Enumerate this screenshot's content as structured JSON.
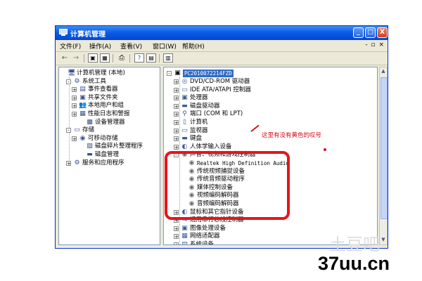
{
  "window": {
    "title": "计算机管理",
    "btn_min": "_",
    "btn_max": "□",
    "btn_close": "X"
  },
  "menubar": {
    "items": [
      "文件(F)",
      "操作(A)",
      "查看(V)",
      "窗口(W)",
      "帮助(H)"
    ],
    "right": "- ▫ ×"
  },
  "toolbar": {
    "buttons": [
      "←",
      "→",
      "▣",
      "▦",
      "⎙",
      "?",
      "▤",
      "▥"
    ]
  },
  "left_tree": {
    "items": [
      {
        "label": "计算机管理 (本地)",
        "icon": "computer-icon",
        "glyph": "🖥",
        "expander": ""
      },
      {
        "label": "系统工具",
        "icon": "tools-icon",
        "glyph": "⚙",
        "expander": "-"
      },
      {
        "label": "事件查看器",
        "icon": "event-viewer-icon",
        "glyph": "▤",
        "expander": "+"
      },
      {
        "label": "共享文件夹",
        "icon": "shared-folder-icon",
        "glyph": "▣",
        "expander": "+"
      },
      {
        "label": "本地用户和组",
        "icon": "users-icon",
        "glyph": "👥",
        "expander": "+"
      },
      {
        "label": "性能日志和警报",
        "icon": "performance-icon",
        "glyph": "▦",
        "expander": "+"
      },
      {
        "label": "设备管理器",
        "icon": "device-manager-icon",
        "glyph": "▩",
        "expander": ""
      },
      {
        "label": "存储",
        "icon": "storage-icon",
        "glyph": "▭",
        "expander": "-"
      },
      {
        "label": "可移动存储",
        "icon": "removable-storage-icon",
        "glyph": "◉",
        "expander": "+"
      },
      {
        "label": "磁盘碎片整理程序",
        "icon": "defrag-icon",
        "glyph": "▨",
        "expander": ""
      },
      {
        "label": "磁盘管理",
        "icon": "disk-management-icon",
        "glyph": "▬",
        "expander": ""
      },
      {
        "label": "服务和应用程序",
        "icon": "services-icon",
        "glyph": "⚙",
        "expander": "+"
      }
    ]
  },
  "right_tree": {
    "root": "PC2010072214FZD",
    "items": [
      {
        "label": "DVD/CD-ROM 驱动器",
        "icon": "cdrom-icon",
        "glyph": "◎",
        "expander": "+"
      },
      {
        "label": "IDE ATA/ATAPI 控制器",
        "icon": "ide-icon",
        "glyph": "▭",
        "expander": "+"
      },
      {
        "label": "处理器",
        "icon": "processor-icon",
        "glyph": "▣",
        "expander": "+"
      },
      {
        "label": "磁盘驱动器",
        "icon": "disk-drive-icon",
        "glyph": "▬",
        "expander": "+"
      },
      {
        "label": "端口 (COM 和 LPT)",
        "icon": "port-icon",
        "glyph": "⚲",
        "expander": "+"
      },
      {
        "label": "计算机",
        "icon": "computer-icon",
        "glyph": "▯",
        "expander": "+"
      },
      {
        "label": "监视器",
        "icon": "monitor-icon",
        "glyph": "▭",
        "expander": "+"
      },
      {
        "label": "键盘",
        "icon": "keyboard-icon",
        "glyph": "▬",
        "expander": "+"
      },
      {
        "label": "人体学输入设备",
        "icon": "hid-icon",
        "glyph": "◐",
        "expander": "+"
      },
      {
        "label": "声音、视频和游戏控制器",
        "icon": "sound-icon",
        "glyph": "◉",
        "expander": "-"
      },
      {
        "label": "Realtek High Definition Audio",
        "icon": "audio-device-icon",
        "glyph": "◉",
        "expander": "",
        "mono": true
      },
      {
        "label": "传统视频捕捉设备",
        "icon": "audio-device-icon",
        "glyph": "◉",
        "expander": ""
      },
      {
        "label": "传统音频驱动程序",
        "icon": "audio-device-icon",
        "glyph": "◉",
        "expander": ""
      },
      {
        "label": "媒体控制设备",
        "icon": "audio-device-icon",
        "glyph": "◉",
        "expander": ""
      },
      {
        "label": "视频编码解码器",
        "icon": "audio-device-icon",
        "glyph": "◉",
        "expander": ""
      },
      {
        "label": "音频编码解码器",
        "icon": "audio-device-icon",
        "glyph": "◉",
        "expander": ""
      },
      {
        "label": "鼠标和其它指针设备",
        "icon": "mouse-icon",
        "glyph": "◐",
        "expander": "+"
      },
      {
        "label": "通用串行总线控制器",
        "icon": "usb-icon",
        "glyph": "⇋",
        "expander": "+"
      },
      {
        "label": "图像处理设备",
        "icon": "imaging-icon",
        "glyph": "▣",
        "expander": "+"
      },
      {
        "label": "网络适配器",
        "icon": "network-icon",
        "glyph": "▦",
        "expander": "+"
      },
      {
        "label": "系统设备",
        "icon": "system-device-icon",
        "glyph": "▤",
        "expander": "+"
      }
    ]
  },
  "annotation": {
    "text": "这里有没有黄色的叹号"
  },
  "watermark": {
    "text": "37uu.cn",
    "faint": "土豆吧"
  },
  "colors": {
    "title_bar": "#0a5ce8",
    "highlight": "#e8141a",
    "selection": "#316ac5"
  }
}
